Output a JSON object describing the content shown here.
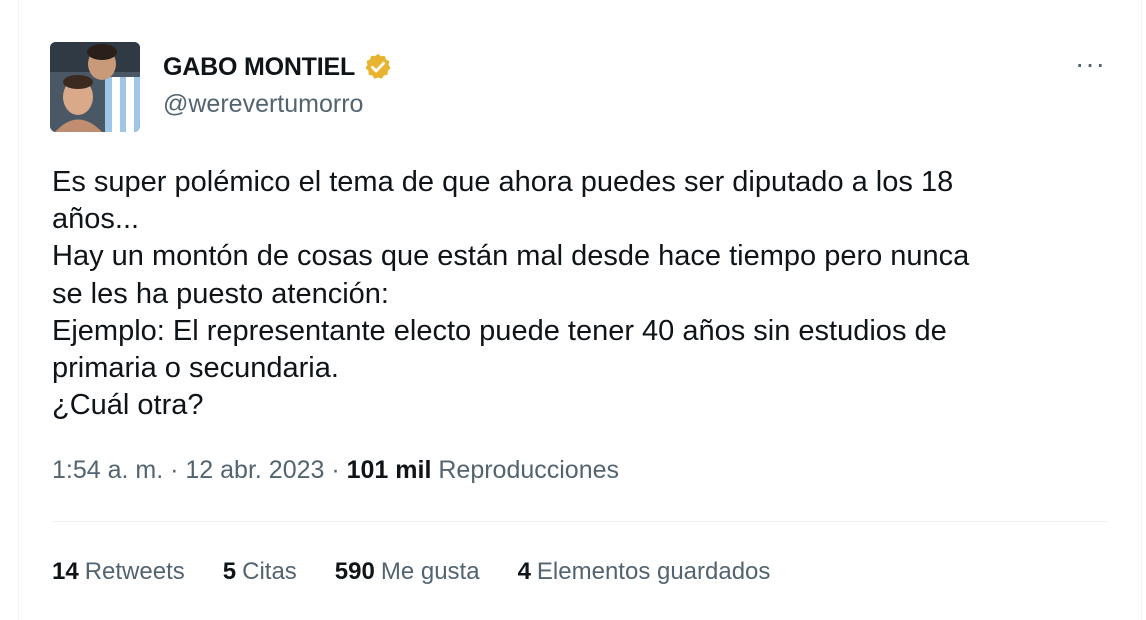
{
  "author": {
    "name": "GABO MONTIEL",
    "handle": "@werevertumorro",
    "verified_color": "#e8b32f"
  },
  "more_label": "···",
  "tweet": {
    "lines": [
      "Es super polémico el tema de que ahora puedes ser diputado a los 18",
      "años...",
      "Hay un montón de cosas que están mal desde hace tiempo pero nunca",
      "se les ha puesto atención:",
      "Ejemplo: El representante electo puede tener 40 años sin estudios de",
      "primaria o secundaria.",
      "¿Cuál otra?"
    ]
  },
  "meta": {
    "time": "1:54 a. m.",
    "sep1": " · ",
    "date": "12 abr. 2023",
    "sep2": " · ",
    "views_count": "101 mil",
    "views_label": "Reproducciones"
  },
  "stats": [
    {
      "count": "14",
      "label": "Retweets"
    },
    {
      "count": "5",
      "label": "Citas"
    },
    {
      "count": "590",
      "label": "Me gusta"
    },
    {
      "count": "4",
      "label": "Elementos guardados"
    }
  ]
}
